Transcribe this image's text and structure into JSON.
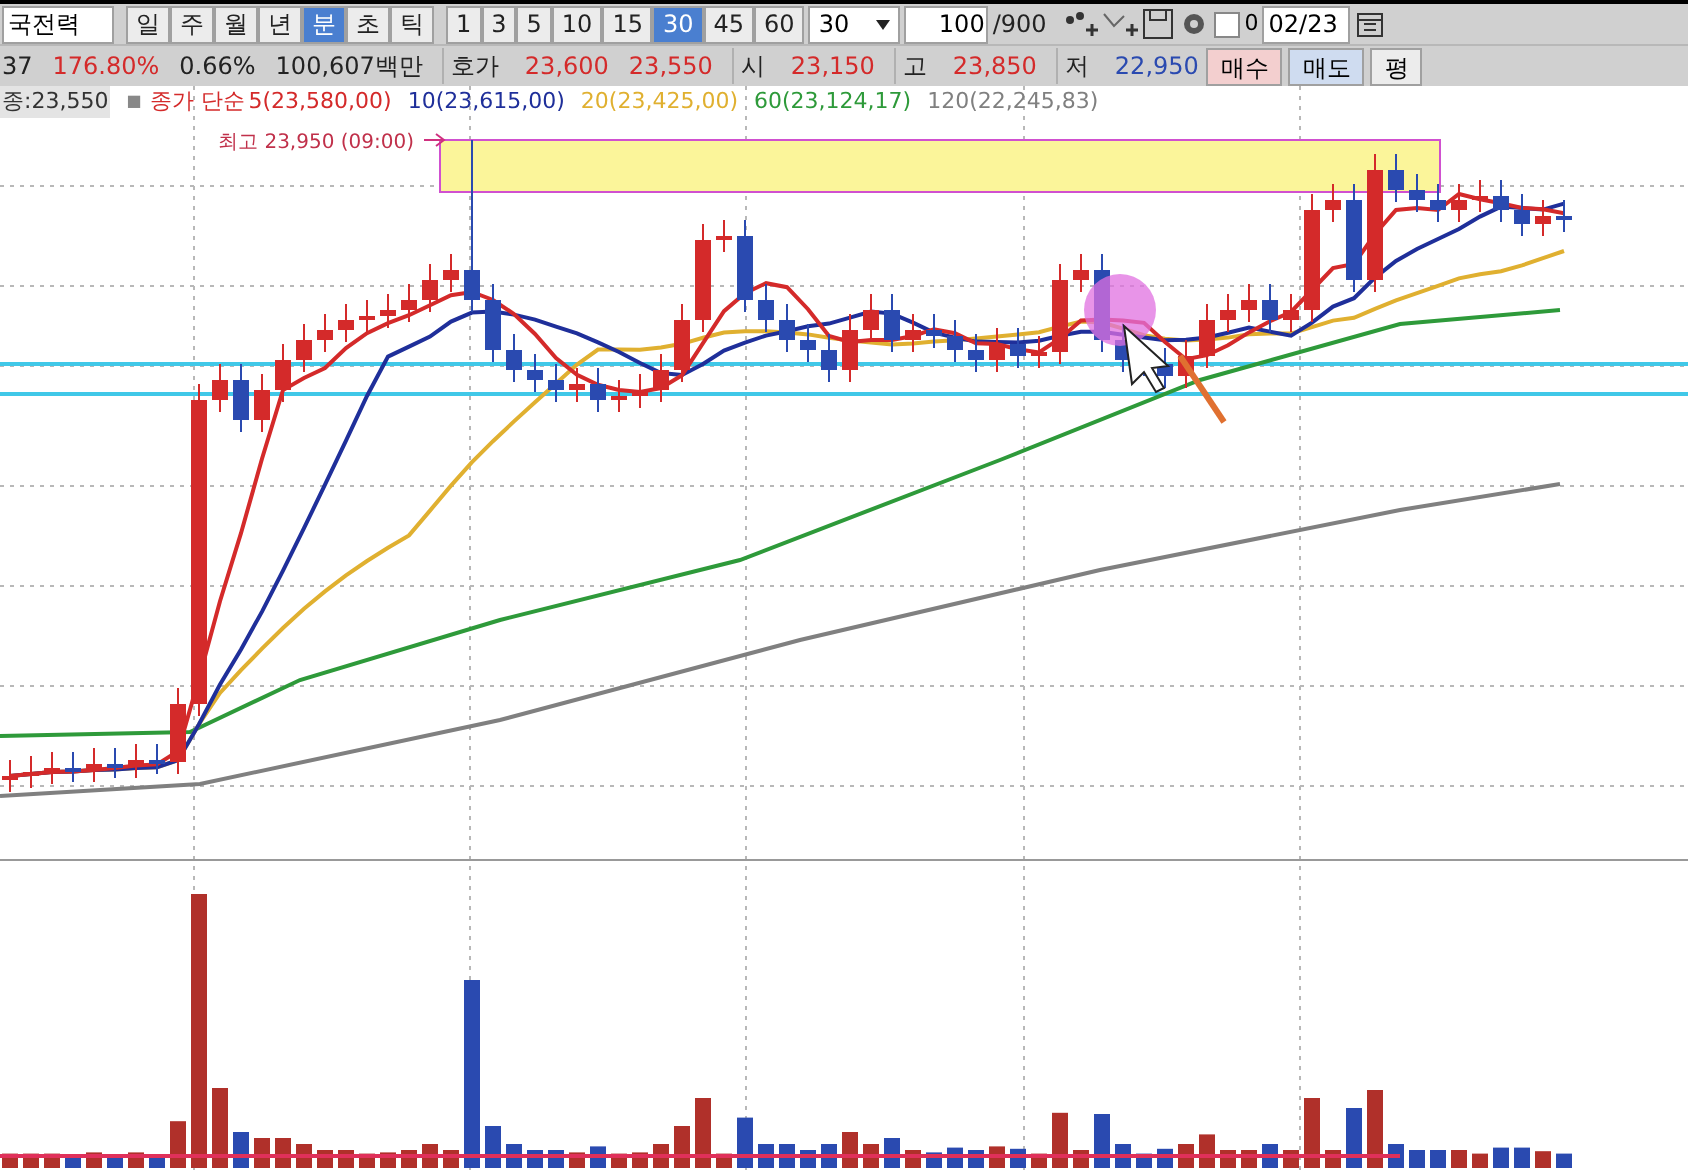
{
  "toolbar": {
    "symbol": "국전력",
    "periods": [
      {
        "label": "일",
        "selected": false
      },
      {
        "label": "주",
        "selected": false
      },
      {
        "label": "월",
        "selected": false
      },
      {
        "label": "년",
        "selected": false
      },
      {
        "label": "분",
        "selected": true
      },
      {
        "label": "초",
        "selected": false
      },
      {
        "label": "틱",
        "selected": false
      }
    ],
    "intervals": [
      {
        "label": "1",
        "selected": false
      },
      {
        "label": "3",
        "selected": false
      },
      {
        "label": "5",
        "selected": false
      },
      {
        "label": "10",
        "selected": false
      },
      {
        "label": "15",
        "selected": false
      },
      {
        "label": "30",
        "selected": true
      },
      {
        "label": "45",
        "selected": false
      },
      {
        "label": "60",
        "selected": false
      }
    ],
    "interval_select": "30",
    "count": "100",
    "count_max": "/900",
    "checkbox": {
      "label": "0",
      "checked": false
    },
    "date": "02/23"
  },
  "quote": {
    "items": [
      {
        "text": "37",
        "kind": "value",
        "color": "#222222"
      },
      {
        "text": "176.80%",
        "kind": "value",
        "color": "#d42a2a"
      },
      {
        "text": "0.66%",
        "kind": "value",
        "color": "#222222"
      },
      {
        "text": "100,607백만",
        "kind": "value",
        "color": "#222222"
      },
      {
        "text": "호가",
        "kind": "label",
        "color": "#222222"
      },
      {
        "text": "23,600",
        "kind": "value",
        "color": "#d42a2a"
      },
      {
        "text": "23,550",
        "kind": "value",
        "color": "#d42a2a"
      },
      {
        "text": "시",
        "kind": "label",
        "color": "#222222"
      },
      {
        "text": "23,150",
        "kind": "value",
        "color": "#d42a2a"
      },
      {
        "text": "고",
        "kind": "label",
        "color": "#222222"
      },
      {
        "text": "23,850",
        "kind": "value",
        "color": "#d42a2a"
      },
      {
        "text": "저",
        "kind": "label",
        "color": "#222222"
      },
      {
        "text": "22,950",
        "kind": "value",
        "color": "#2a4ab0"
      }
    ],
    "buttons": [
      {
        "label": "매수",
        "kind": "buy"
      },
      {
        "label": "매도",
        "kind": "sell"
      },
      {
        "label": "평",
        "kind": "plain"
      }
    ]
  },
  "legend": {
    "close": "종:23,550",
    "marker": "■",
    "title": "종가 단순",
    "averages": [
      {
        "label": "5(23,580,00)",
        "color": "#d42a2a"
      },
      {
        "label": "10(23,615,00)",
        "color": "#1f2f9a"
      },
      {
        "label": "20(23,425,00)",
        "color": "#e0b030"
      },
      {
        "label": "60(23,124,17)",
        "color": "#2e9a3a"
      },
      {
        "label": "120(22,245,83)",
        "color": "#808080"
      }
    ]
  },
  "chart": {
    "annotation": "최고 23,950 (09:00)"
  }
}
